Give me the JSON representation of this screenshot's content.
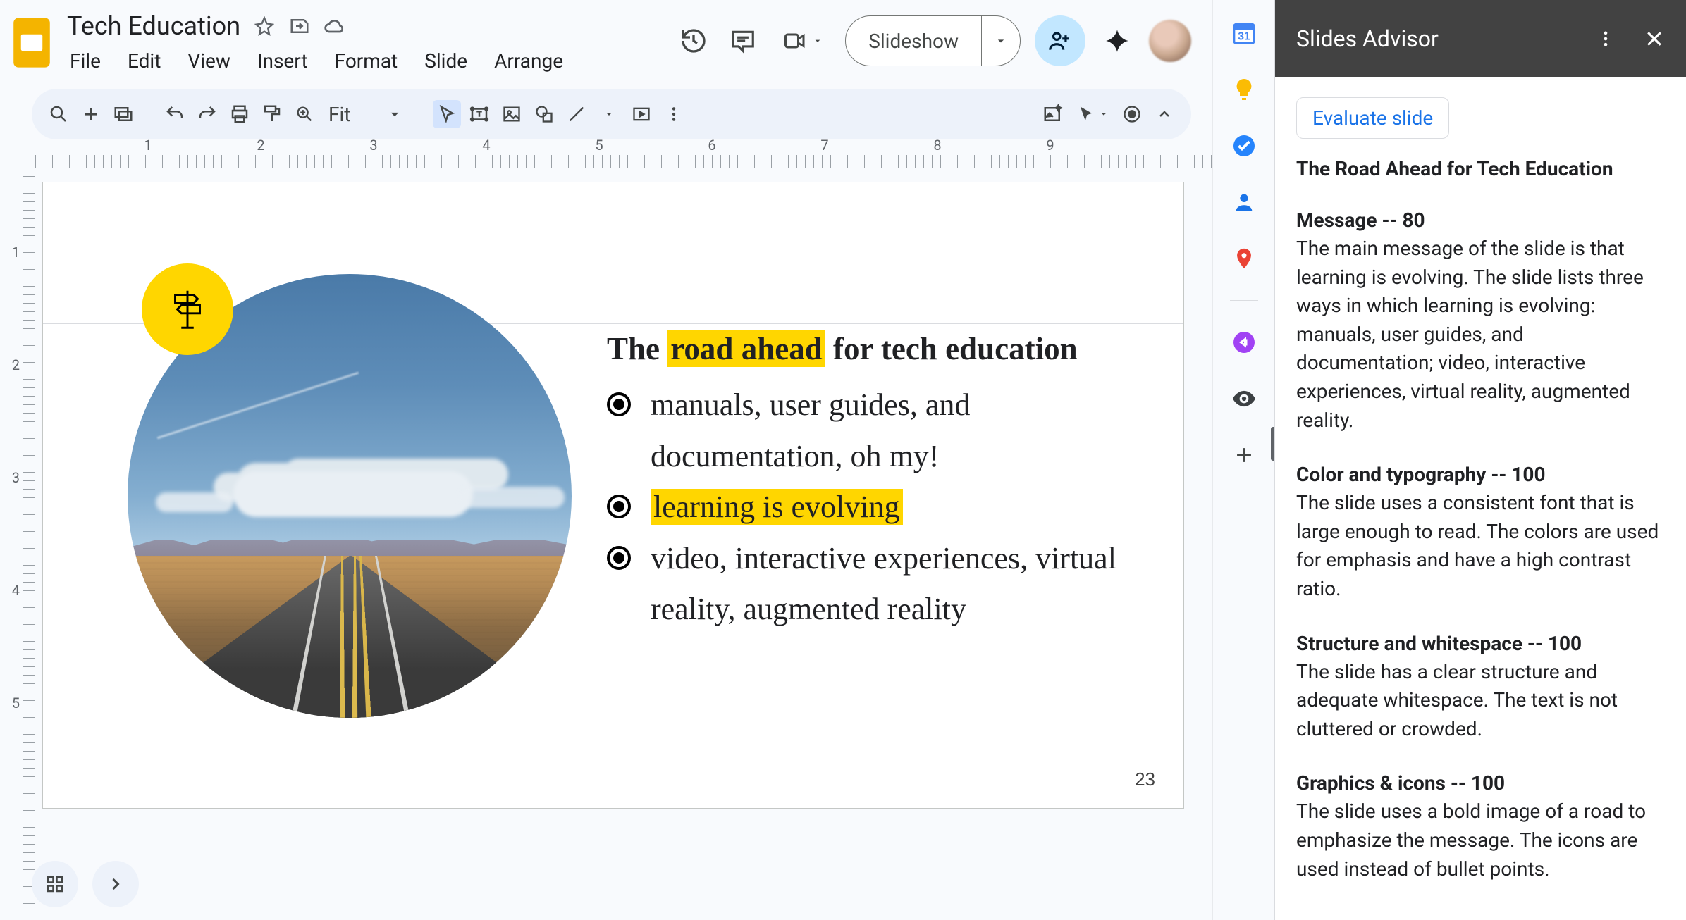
{
  "doc": {
    "title": "Tech Education"
  },
  "menus": [
    "File",
    "Edit",
    "View",
    "Insert",
    "Format",
    "Slide",
    "Arrange"
  ],
  "toolbar": {
    "zoom": "Fit"
  },
  "slideshow_label": "Slideshow",
  "ruler_h": [
    "1",
    "2",
    "3",
    "4",
    "5",
    "6",
    "7",
    "8",
    "9"
  ],
  "ruler_v": [
    "1",
    "2",
    "3",
    "4",
    "5"
  ],
  "slide": {
    "number": "23",
    "title_pre": "The ",
    "title_hl": "road ahead",
    "title_post": " for tech education",
    "bullets": [
      {
        "text": "manuals, user guides, and documentation, oh my!",
        "hl": false
      },
      {
        "text": "learning is evolving",
        "hl": true
      },
      {
        "text": "video, interactive experiences, virtual reality, augmented reality",
        "hl": false
      }
    ]
  },
  "advisor": {
    "title": "Slides Advisor",
    "button": "Evaluate slide",
    "slide_title": "The Road Ahead for Tech Education",
    "sections": [
      {
        "heading": "Message -- 80",
        "text": "The main message of the slide is that learning is evolving. The slide lists three ways in which learning is evolving: manuals, user guides, and documentation; video, interactive experiences, virtual reality, augmented reality."
      },
      {
        "heading": "Color and typography -- 100",
        "text": "The slide uses a consistent font that is large enough to read. The colors are used for emphasis and have a high contrast ratio."
      },
      {
        "heading": "Structure and whitespace -- 100",
        "text": "The slide has a clear structure and adequate whitespace. The text is not cluttered or crowded."
      },
      {
        "heading": "Graphics & icons -- 100",
        "text": "The slide uses a bold image of a road to emphasize the message. The icons are used instead of bullet points."
      }
    ]
  }
}
